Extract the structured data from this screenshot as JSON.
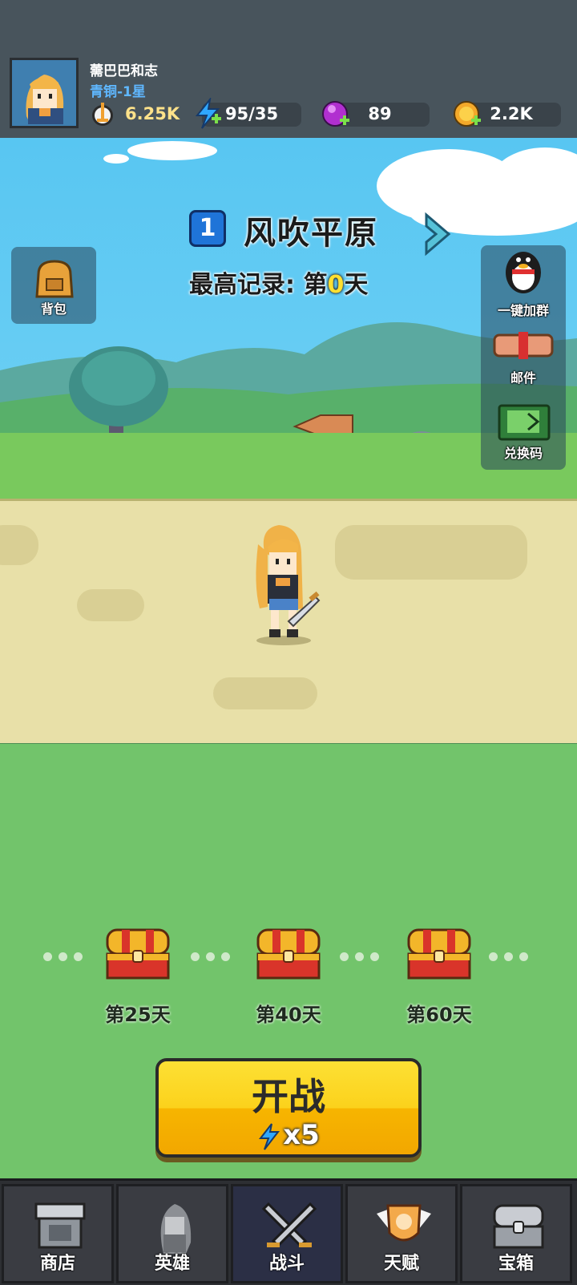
{
  "player": {
    "name": "薷巴巴和志",
    "rank": "青铜-1星"
  },
  "resources": {
    "power": {
      "icon": "sword-trophy-icon",
      "value": "6.25K"
    },
    "energy": {
      "icon": "lightning-icon",
      "value": "95/35"
    },
    "gems": {
      "icon": "purple-gem-icon",
      "value": "89"
    },
    "gold": {
      "icon": "gold-coin-icon",
      "value": "2.2K"
    }
  },
  "stage": {
    "number": "1",
    "name": "风吹平原",
    "record_prefix": "最高记录: 第",
    "record_value": "0",
    "record_suffix": "天"
  },
  "side_buttons": {
    "backpack": "背包",
    "join_group": "一键加群",
    "mail": "邮件",
    "redeem": "兑换码"
  },
  "milestones": [
    {
      "label": "第25天",
      "icon": "treasure-chest-icon"
    },
    {
      "label": "第40天",
      "icon": "treasure-chest-icon"
    },
    {
      "label": "第60天",
      "icon": "treasure-chest-icon"
    }
  ],
  "start": {
    "label": "开战",
    "cost": "x5"
  },
  "nav": {
    "shop": "商店",
    "heroes": "英雄",
    "battle": "战斗",
    "talent": "天赋",
    "chest": "宝箱",
    "active": "battle"
  },
  "colors": {
    "topbar": "#48545c",
    "sky": "#58c6f2",
    "road": "#e8e0a8",
    "field": "#72c46b",
    "start_button": "#fbd21c",
    "accent_blue": "#1f74d8"
  }
}
